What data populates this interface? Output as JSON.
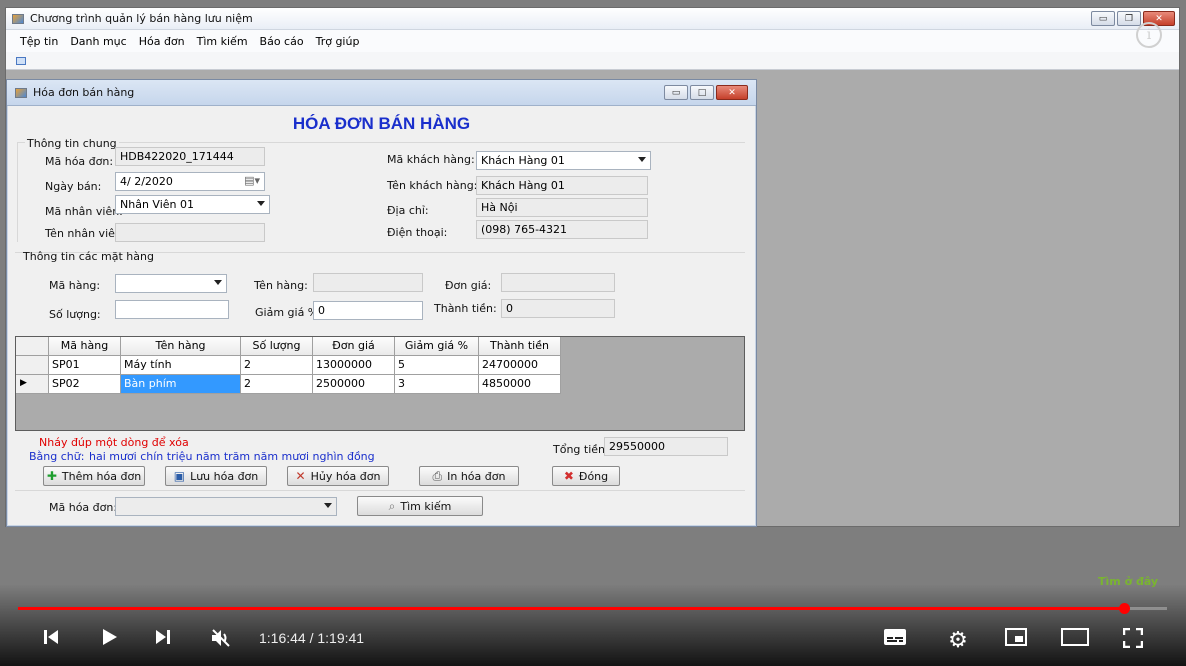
{
  "window": {
    "title": "Chương trình quản lý bán hàng lưu niệm"
  },
  "menu": [
    "Tệp tin",
    "Danh mục",
    "Hóa đơn",
    "Tìm kiếm",
    "Báo cáo",
    "Trợ giúp"
  ],
  "info_icon": "i",
  "child": {
    "title": "Hóa đơn bán hàng",
    "heading": "HÓA ĐƠN BÁN HÀNG",
    "general": {
      "section": "Thông tin chung",
      "ma_hoa_don_label": "Mã hóa đơn:",
      "ma_hoa_don": "HDB422020_171444",
      "ngay_ban_label": "Ngày bán:",
      "ngay_ban": "4/  2/2020",
      "ma_nv_label": "Mã nhân viên:",
      "ma_nv": "Nhân Viên 01",
      "ten_nv_label": "Tên nhân viên:",
      "ten_nv": "",
      "ma_kh_label": "Mã khách hàng:",
      "ma_kh": "Khách Hàng 01",
      "ten_kh_label": "Tên khách hàng:",
      "ten_kh": "Khách Hàng 01",
      "dia_chi_label": "Địa chỉ:",
      "dia_chi": "Hà Nội",
      "dien_thoai_label": "Điện thoại:",
      "dien_thoai": "(098) 765-4321"
    },
    "items": {
      "section": "Thông tin các mặt hàng",
      "ma_hang_label": "Mã hàng:",
      "ma_hang": "",
      "ten_hang_label": "Tên hàng:",
      "ten_hang": "",
      "don_gia_label": "Đơn giá:",
      "don_gia": "",
      "so_luong_label": "Số lượng:",
      "so_luong": "",
      "giam_gia_label": "Giảm giá %:",
      "giam_gia": "0",
      "thanh_tien_label": "Thành tiền:",
      "thanh_tien": "0"
    },
    "grid": {
      "headers": [
        "Mã hàng",
        "Tên hàng",
        "Số lượng",
        "Đơn giá",
        "Giảm giá %",
        "Thành tiền"
      ],
      "rows": [
        [
          "SP01",
          "Máy tính",
          "2",
          "13000000",
          "5",
          "24700000"
        ],
        [
          "SP02",
          "Bàn phím",
          "2",
          "2500000",
          "3",
          "4850000"
        ]
      ]
    },
    "hint": "Nháy đúp một dòng để xóa",
    "words_label": "Bằng chữ:",
    "words": "hai mươi chín triệu năm trăm năm mươi nghìn đồng",
    "total_label": "Tổng tiền:",
    "total": "29550000",
    "buttons": {
      "add": "Thêm hóa đơn",
      "save": "Lưu hóa đơn",
      "cancel": "Hủy hóa đơn",
      "print": "In hóa đơn",
      "close": "Đóng"
    },
    "search": {
      "label": "Mã hóa đơn:",
      "value": "",
      "button": "Tìm kiếm"
    }
  },
  "player": {
    "time": "1:16:44 / 1:19:41",
    "progress": 0.963,
    "watermark": "Tìm ở đây"
  },
  "colors": {
    "heading": "#1a2fcc",
    "hint": "#e00000",
    "words": "#1a2fcc",
    "progress": "#ff0000"
  }
}
